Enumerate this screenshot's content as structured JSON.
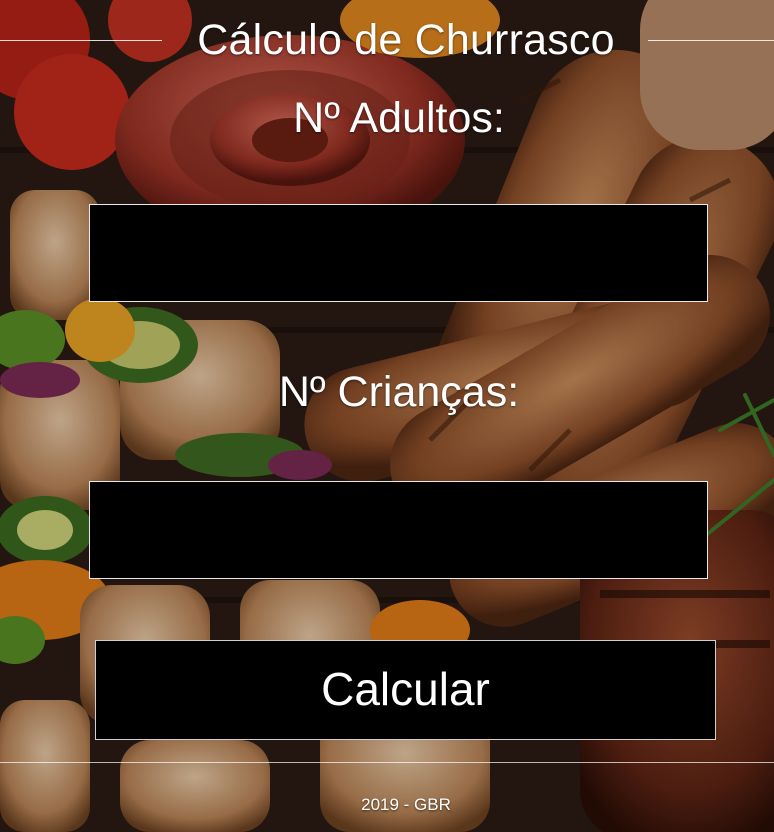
{
  "page": {
    "title": "Cálculo de Churrasco"
  },
  "form": {
    "adults_label": "Nº Adultos:",
    "adults_value": "",
    "children_label": "Nº Crianças:",
    "children_value": "",
    "submit_label": "Calcular"
  },
  "footer": {
    "text": "2019 - GBR"
  },
  "colors": {
    "field_background": "#000000",
    "text": "#ffffff"
  }
}
